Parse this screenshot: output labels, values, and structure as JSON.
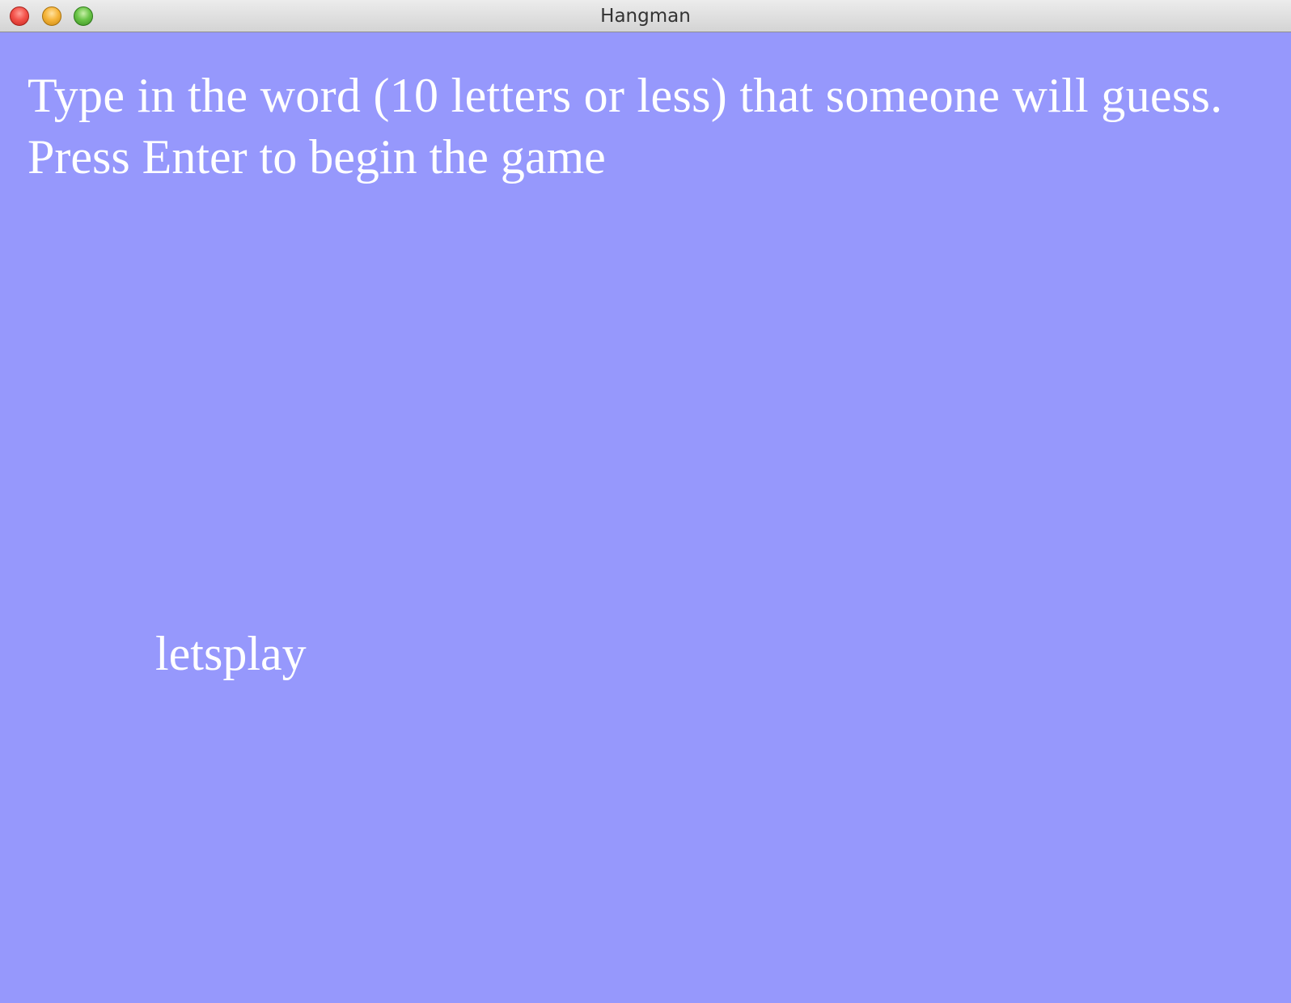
{
  "window": {
    "title": "Hangman",
    "controls": {
      "close": "close-button",
      "minimize": "minimize-button",
      "zoom": "zoom-button"
    }
  },
  "game": {
    "prompt_line_1": "Type in the word (10 letters or less) that someone will guess.",
    "prompt_line_2": " Press Enter to begin the game",
    "typed_word": "letsplay"
  },
  "colors": {
    "background": "#9698fc",
    "text": "#ffffff"
  }
}
